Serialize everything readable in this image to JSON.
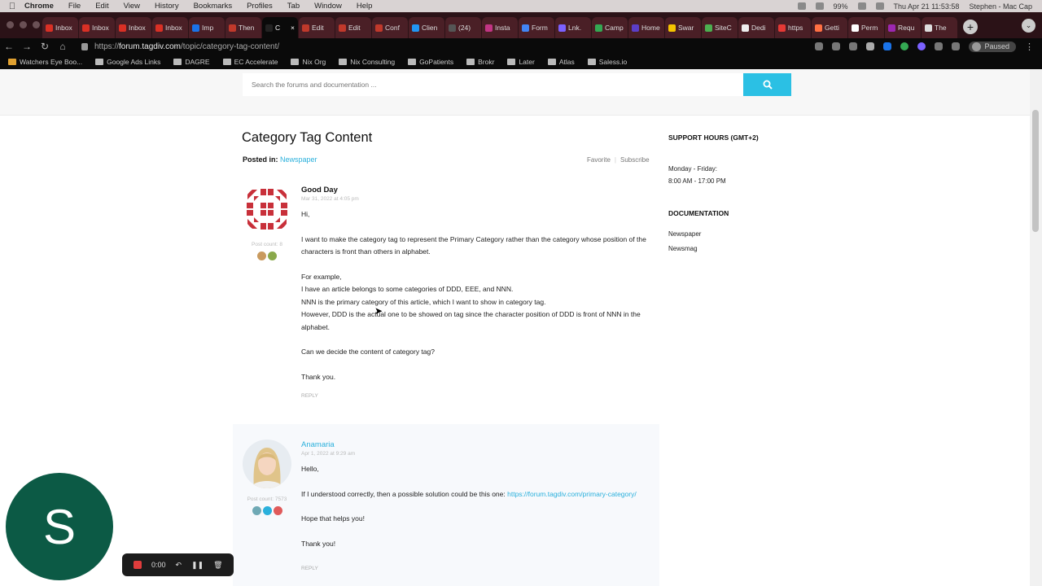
{
  "menubar": {
    "app": "Chrome",
    "items": [
      "File",
      "Edit",
      "View",
      "History",
      "Bookmarks",
      "Profiles",
      "Tab",
      "Window",
      "Help"
    ],
    "battery": "99%",
    "clock": "Thu Apr 21  11:53:58",
    "user": "Stephen - Mac Cap"
  },
  "tabs": [
    {
      "label": "Inbox",
      "color": "#d93025"
    },
    {
      "label": "Inbox",
      "color": "#d93025"
    },
    {
      "label": "Inbox",
      "color": "#d93025"
    },
    {
      "label": "Inbox",
      "color": "#d93025"
    },
    {
      "label": "Imp",
      "color": "#1a73e8"
    },
    {
      "label": "Then",
      "color": "#c0392b"
    },
    {
      "label": "C",
      "color": "#222",
      "active": true
    },
    {
      "label": "Edit",
      "color": "#c0392b"
    },
    {
      "label": "Edit",
      "color": "#c0392b"
    },
    {
      "label": "Conf",
      "color": "#c0392b"
    },
    {
      "label": "Clien",
      "color": "#2196f3"
    },
    {
      "label": "(24)",
      "color": "#555"
    },
    {
      "label": "Insta",
      "color": "#c13584"
    },
    {
      "label": "Form",
      "color": "#4285f4"
    },
    {
      "label": "Lnk.",
      "color": "#7b61ff"
    },
    {
      "label": "Camp",
      "color": "#34a853"
    },
    {
      "label": "Home",
      "color": "#5b3ec8"
    },
    {
      "label": "Swar",
      "color": "#f5c400"
    },
    {
      "label": "SiteC",
      "color": "#4caf50"
    },
    {
      "label": "Dedi",
      "color": "#eee"
    },
    {
      "label": "https",
      "color": "#e53935"
    },
    {
      "label": "Getti",
      "color": "#ff7043"
    },
    {
      "label": "Perm",
      "color": "#fff"
    },
    {
      "label": "Requ",
      "color": "#9c27b0"
    },
    {
      "label": "The",
      "color": "#ddd"
    }
  ],
  "address": {
    "scheme": "https://",
    "host": "forum.tagdiv.com",
    "path": "/topic/category-tag-content/"
  },
  "paused": "Paused",
  "bookmarks": [
    "Watchers Eye Boo...",
    "Google Ads Links",
    "DAGRE",
    "EC Accelerate",
    "Nix Org",
    "Nix Consulting",
    "GoPatients",
    "Brokr",
    "Later",
    "Atlas",
    "Saless.io"
  ],
  "search": {
    "placeholder": "Search the forums and documentation ..."
  },
  "topic": {
    "title": "Category Tag Content",
    "posted_label": "Posted in:",
    "category": "Newspaper",
    "favorite": "Favorite",
    "sep": "|",
    "subscribe": "Subscribe"
  },
  "posts": [
    {
      "author": "Good Day",
      "date": "Mar 31, 2022 at 4:05 pm",
      "post_count": "Post count: 8",
      "p1": "Hi,",
      "p2": "I want to make the category tag to represent the Primary Category rather than the category whose position of the characters is front than others in alphabet.",
      "p3a": "For example,",
      "p3b": "I have an article belongs to some categories of DDD, EEE, and NNN.",
      "p3c": "NNN is the primary category of this article, which I want to show in category tag.",
      "p3d": "However, DDD is the actual one to be showed on tag since the character position of DDD is front of NNN in the alphabet.",
      "p4": "Can we decide the content of category tag?",
      "p5": "Thank you.",
      "reply": "REPLY"
    },
    {
      "author": "Anamaria",
      "date": "Apr 1, 2022 at 9:29 am",
      "post_count": "Post count: 7573",
      "p1": "Hello,",
      "p2": "If I understood correctly, then a possible solution could be this one:",
      "link": "https://forum.tagdiv.com/primary-category/",
      "p3": "Hope that helps you!",
      "p4": "Thank you!",
      "reply": "REPLY"
    }
  ],
  "sidebar": {
    "hours_title": "SUPPORT HOURS (GMT+2)",
    "hours_days": "Monday - Friday:",
    "hours_time": "8:00 AM - 17:00 PM",
    "doc_title": "DOCUMENTATION",
    "doc_items": [
      "Newspaper",
      "Newsmag"
    ]
  },
  "presenter": {
    "initial": "S"
  },
  "recorder": {
    "time": "0:00"
  }
}
